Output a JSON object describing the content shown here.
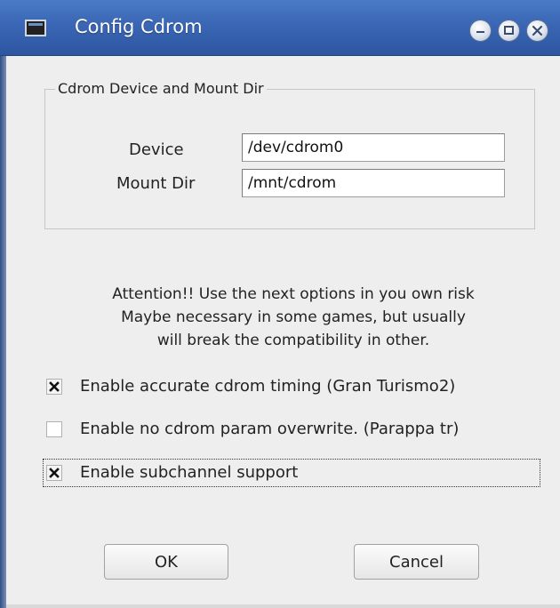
{
  "window": {
    "title": "Config Cdrom",
    "icons": [
      "window-app-icon",
      "minimize-icon",
      "maximize-icon",
      "close-icon"
    ]
  },
  "group": {
    "title": "Cdrom Device and Mount Dir",
    "device_label": "Device",
    "device_value": "/dev/cdrom0",
    "mount_label": "Mount Dir",
    "mount_value": "/mnt/cdrom"
  },
  "attention": {
    "line1": "Attention!! Use the next options in you own risk",
    "line2": "Maybe necessary in some games, but usually",
    "line3": "will break the compatibility in other."
  },
  "options": [
    {
      "label": "Enable accurate cdrom timing (Gran Turismo2)",
      "checked": true
    },
    {
      "label": "Enable no cdrom param overwrite. (Parappa tr)",
      "checked": false
    },
    {
      "label": "Enable subchannel support",
      "checked": true
    }
  ],
  "buttons": {
    "ok": "OK",
    "cancel": "Cancel"
  }
}
